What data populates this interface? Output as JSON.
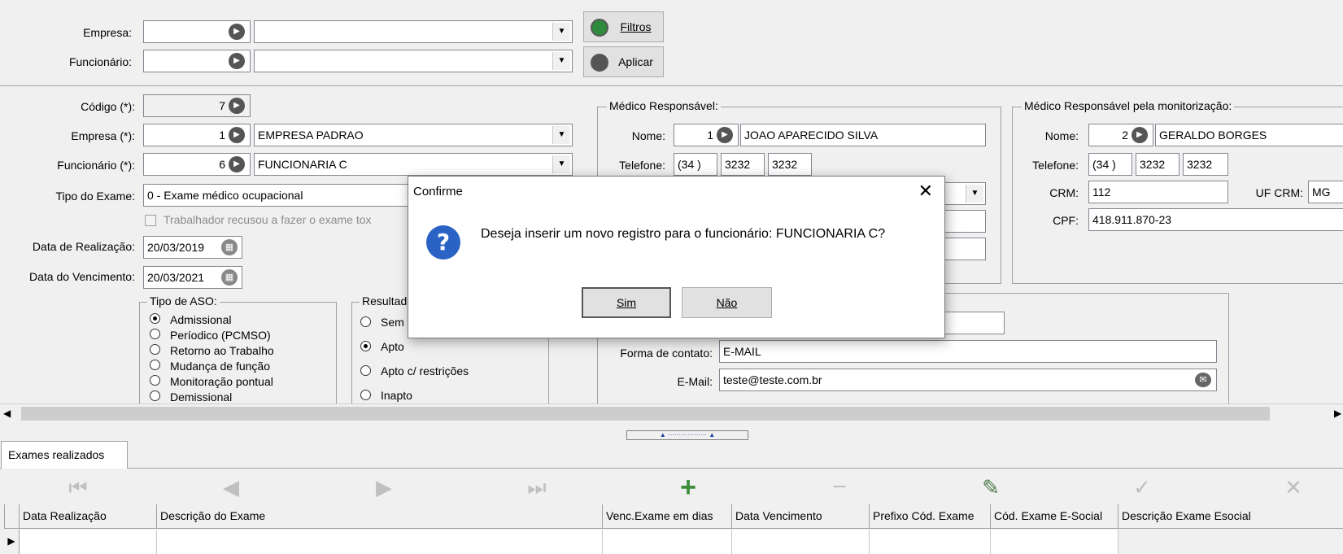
{
  "filter": {
    "empresa_label": "Empresa:",
    "funcionario_label": "Funcionário:",
    "filtros_btn": "Filtros",
    "aplicar_btn": "Aplicar"
  },
  "form": {
    "codigo_label": "Código (*):",
    "codigo_value": "7",
    "empresa_label": "Empresa (*):",
    "empresa_code": "1",
    "empresa_name": "EMPRESA PADRAO",
    "funcionario_label": "Funcionário (*):",
    "funcionario_code": "6",
    "funcionario_name": "FUNCIONARIA C",
    "tipo_exame_label": "Tipo do Exame:",
    "tipo_exame_value": "0 - Exame médico ocupacional",
    "trabalhador_recusou": "Trabalhador recusou a fazer o exame tox",
    "data_realizacao_label": "Data de Realização:",
    "data_realizacao_value": "20/03/2019",
    "data_vencimento_label": "Data do Vencimento:",
    "data_vencimento_value": "20/03/2021"
  },
  "tipo_aso": {
    "title": "Tipo de ASO:",
    "options": [
      "Admissional",
      "Períodico (PCMSO)",
      "Retorno ao Trabalho",
      "Mudança de função",
      "Monitoração pontual",
      "Demissional"
    ],
    "selected": "Admissional"
  },
  "resultado": {
    "title": "Resultad",
    "options": [
      "Sem",
      "Apto",
      "Apto c/ restrições",
      "Inapto"
    ],
    "selected": "Apto"
  },
  "medico": {
    "title": "Médico Responsável:",
    "nome_label": "Nome:",
    "codigo": "1",
    "nome": "JOAO APARECIDO SILVA",
    "telefone_label": "Telefone:",
    "ddd": "(34  )",
    "tel1": "3232",
    "tel2": "3232"
  },
  "medico_monitor": {
    "title": "Médico Responsável pela monitorização:",
    "nome_label": "Nome:",
    "codigo": "2",
    "nome": "GERALDO BORGES",
    "telefone_label": "Telefone:",
    "ddd": "(34  )",
    "tel1": "3232",
    "tel2": "3232",
    "crm_label": "CRM:",
    "crm": "112",
    "uf_crm_label": "UF CRM:",
    "uf_crm": "MG",
    "cpf_label": "CPF:",
    "cpf": "418.911.870-23"
  },
  "contato": {
    "forma_label": "Forma de contato:",
    "forma": "E-MAIL",
    "email_label": "E-Mail:",
    "email": "teste@teste.com.br"
  },
  "tab": {
    "label": "Exames realizados"
  },
  "grid": {
    "columns": [
      "Data Realização",
      "Descrição do Exame",
      "Venc.Exame em dias",
      "Data Vencimento",
      "Prefixo Cód. Exame",
      "Cód. Exame E-Social",
      "Descrição Exame Esocial"
    ]
  },
  "dialog": {
    "title": "Confirme",
    "message": "Deseja inserir um novo registro para o funcionário: FUNCIONARIA C?",
    "yes": "Sim",
    "no": "Não"
  },
  "icons": {
    "lookup": "lookup-arrow-icon",
    "calendar": "calendar-icon",
    "question": "question-icon",
    "email": "email-icon"
  },
  "colors": {
    "background": "#f0f0f0",
    "question_blue": "#2a63c4",
    "add_green": "#3c8c3c"
  }
}
